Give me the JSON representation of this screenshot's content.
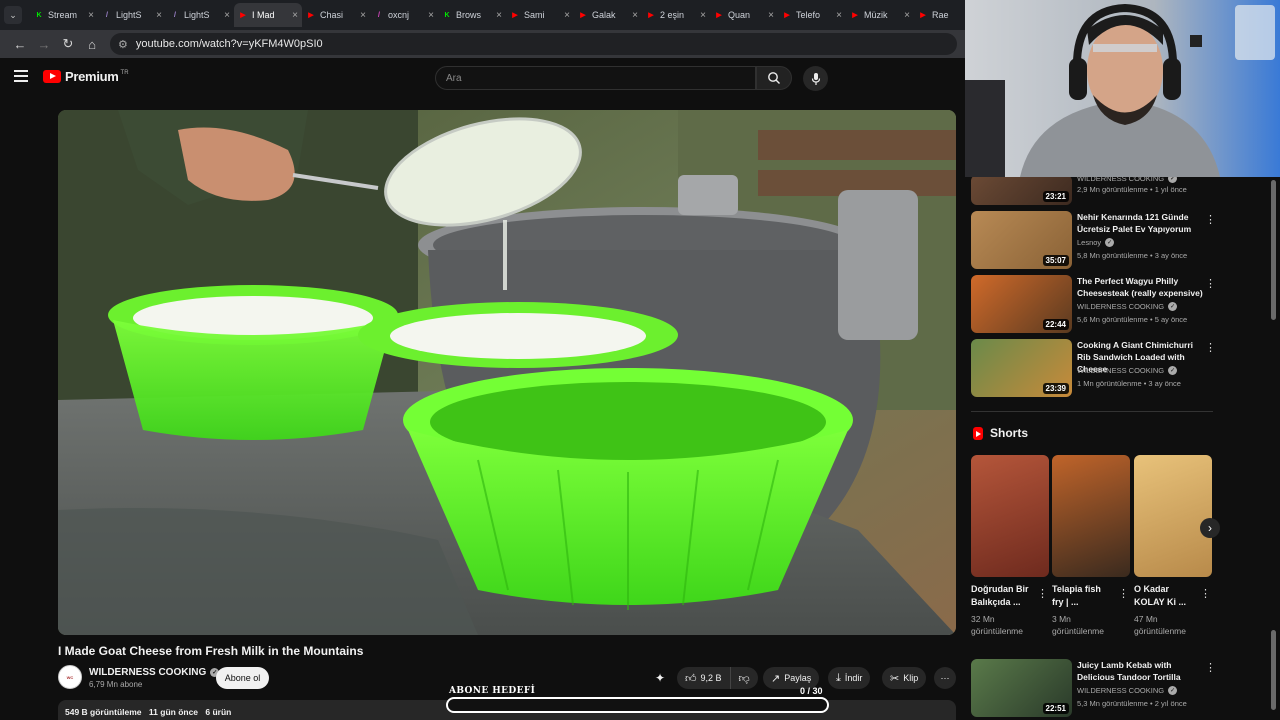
{
  "browser": {
    "tabs": [
      {
        "label": "Stream",
        "icon_color": "#00e701",
        "icon_char": "K"
      },
      {
        "label": "LightS",
        "icon_color": "#a88bd9",
        "icon_char": "/"
      },
      {
        "label": "LightS",
        "icon_color": "#a88bd9",
        "icon_char": "/"
      },
      {
        "label": "I Mad",
        "icon_color": "#ff0000",
        "icon_char": "▶",
        "active": true
      },
      {
        "label": "Chasi",
        "icon_color": "#ff0000",
        "icon_char": "▶"
      },
      {
        "label": "oxcnj",
        "icon_color": "#e84bd0",
        "icon_char": "/"
      },
      {
        "label": "Brows",
        "icon_color": "#00e701",
        "icon_char": "K"
      },
      {
        "label": "Sami",
        "icon_color": "#ff0000",
        "icon_char": "▶"
      },
      {
        "label": "Galak",
        "icon_color": "#ff0000",
        "icon_char": "▶"
      },
      {
        "label": "2 eşin",
        "icon_color": "#ff0000",
        "icon_char": "▶"
      },
      {
        "label": "Quan",
        "icon_color": "#ff0000",
        "icon_char": "▶"
      },
      {
        "label": "Telefo",
        "icon_color": "#ff0000",
        "icon_char": "▶"
      },
      {
        "label": "Müzik",
        "icon_color": "#ff0000",
        "icon_char": "▶"
      },
      {
        "label": "Rae",
        "icon_color": "#ff0000",
        "icon_char": "▶"
      }
    ],
    "url": "youtube.com/watch?v=yKFM4W0pSI0"
  },
  "header": {
    "brand": "Premium",
    "country": "TR",
    "search_placeholder": "Ara"
  },
  "video": {
    "title": "I Made Goat Cheese from Fresh Milk in the Mountains",
    "channel": "WILDERNESS COOKING",
    "subscribers": "6,79 Mn abone",
    "subscribe_label": "Abone ol",
    "like_count": "9,2 B",
    "share_label": "Paylaş",
    "download_label": "İndir",
    "clip_label": "Klip",
    "views": "549 B görüntüleme",
    "age": "11 gün önce",
    "products": "6 ürün"
  },
  "overlay": {
    "goal_label": "ABONE HEDEFİ",
    "goal_count": "0 / 30",
    "goal_progress": 0
  },
  "recommendations": [
    {
      "title": "",
      "channel": "WILDERNESS COOKING",
      "views": "2,9 Mn görüntülenme",
      "age": "1 yıl önce",
      "duration": "23:21",
      "verified": true
    },
    {
      "title": "Nehir Kenarında 121 Günde Ücretsiz Palet Ev Yapıyorum",
      "channel": "Lesnoy",
      "views": "5,8 Mn görüntülenme",
      "age": "3 ay önce",
      "duration": "35:07",
      "verified": true
    },
    {
      "title": "The Perfect Wagyu Philly Cheesesteak (really expensive)",
      "channel": "WILDERNESS COOKING",
      "views": "5,6 Mn görüntülenme",
      "age": "5 ay önce",
      "duration": "22:44",
      "verified": true
    },
    {
      "title": "Cooking A Giant Chimichurri Rib Sandwich Loaded with Cheese",
      "channel": "WILDERNESS COOKING",
      "views": "1 Mn görüntülenme",
      "age": "3 ay önce",
      "duration": "23:39",
      "verified": true
    },
    {
      "title": "Juicy Lamb Kebab with Delicious Tandoor Tortilla",
      "channel": "WILDERNESS COOKING",
      "views": "5,3 Mn görüntülenme",
      "age": "2 yıl önce",
      "duration": "22:51",
      "verified": true
    }
  ],
  "shorts": {
    "heading": "Shorts",
    "items": [
      {
        "title": "Doğrudan Bir Balıkçıda ...",
        "views": "32 Mn görüntülenme"
      },
      {
        "title": "Telapia fish fry | ...",
        "views": "3 Mn görüntülenme"
      },
      {
        "title": "O Kadar KOLAY Ki ...",
        "views": "47 Mn görüntülenme"
      }
    ]
  }
}
